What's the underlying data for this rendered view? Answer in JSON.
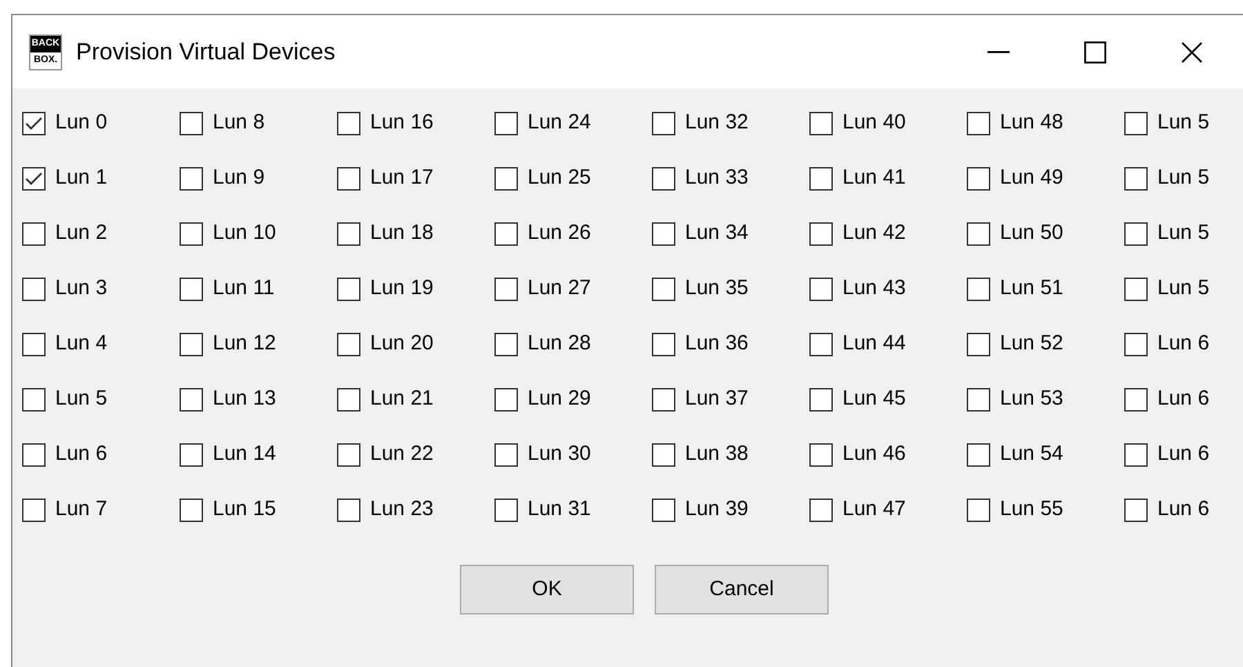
{
  "window": {
    "title": "Provision Virtual Devices",
    "icon_text": [
      "BACK",
      "BOX."
    ]
  },
  "luns": [
    {
      "label": "Lun 0",
      "checked": true
    },
    {
      "label": "Lun 1",
      "checked": true
    },
    {
      "label": "Lun 2",
      "checked": false
    },
    {
      "label": "Lun 3",
      "checked": false
    },
    {
      "label": "Lun 4",
      "checked": false
    },
    {
      "label": "Lun 5",
      "checked": false
    },
    {
      "label": "Lun 6",
      "checked": false
    },
    {
      "label": "Lun 7",
      "checked": false
    },
    {
      "label": "Lun 8",
      "checked": false
    },
    {
      "label": "Lun 9",
      "checked": false
    },
    {
      "label": "Lun 10",
      "checked": false
    },
    {
      "label": "Lun 11",
      "checked": false
    },
    {
      "label": "Lun 12",
      "checked": false
    },
    {
      "label": "Lun 13",
      "checked": false
    },
    {
      "label": "Lun 14",
      "checked": false
    },
    {
      "label": "Lun 15",
      "checked": false
    },
    {
      "label": "Lun 16",
      "checked": false
    },
    {
      "label": "Lun 17",
      "checked": false
    },
    {
      "label": "Lun 18",
      "checked": false
    },
    {
      "label": "Lun 19",
      "checked": false
    },
    {
      "label": "Lun 20",
      "checked": false
    },
    {
      "label": "Lun 21",
      "checked": false
    },
    {
      "label": "Lun 22",
      "checked": false
    },
    {
      "label": "Lun 23",
      "checked": false
    },
    {
      "label": "Lun 24",
      "checked": false
    },
    {
      "label": "Lun 25",
      "checked": false
    },
    {
      "label": "Lun 26",
      "checked": false
    },
    {
      "label": "Lun 27",
      "checked": false
    },
    {
      "label": "Lun 28",
      "checked": false
    },
    {
      "label": "Lun 29",
      "checked": false
    },
    {
      "label": "Lun 30",
      "checked": false
    },
    {
      "label": "Lun 31",
      "checked": false
    },
    {
      "label": "Lun 32",
      "checked": false
    },
    {
      "label": "Lun 33",
      "checked": false
    },
    {
      "label": "Lun 34",
      "checked": false
    },
    {
      "label": "Lun 35",
      "checked": false
    },
    {
      "label": "Lun 36",
      "checked": false
    },
    {
      "label": "Lun 37",
      "checked": false
    },
    {
      "label": "Lun 38",
      "checked": false
    },
    {
      "label": "Lun 39",
      "checked": false
    },
    {
      "label": "Lun 40",
      "checked": false
    },
    {
      "label": "Lun 41",
      "checked": false
    },
    {
      "label": "Lun 42",
      "checked": false
    },
    {
      "label": "Lun 43",
      "checked": false
    },
    {
      "label": "Lun 44",
      "checked": false
    },
    {
      "label": "Lun 45",
      "checked": false
    },
    {
      "label": "Lun 46",
      "checked": false
    },
    {
      "label": "Lun 47",
      "checked": false
    },
    {
      "label": "Lun 48",
      "checked": false
    },
    {
      "label": "Lun 49",
      "checked": false
    },
    {
      "label": "Lun 50",
      "checked": false
    },
    {
      "label": "Lun 51",
      "checked": false
    },
    {
      "label": "Lun 52",
      "checked": false
    },
    {
      "label": "Lun 53",
      "checked": false
    },
    {
      "label": "Lun 54",
      "checked": false
    },
    {
      "label": "Lun 55",
      "checked": false
    },
    {
      "label": "Lun 5",
      "checked": false
    },
    {
      "label": "Lun 5",
      "checked": false
    },
    {
      "label": "Lun 5",
      "checked": false
    },
    {
      "label": "Lun 5",
      "checked": false
    },
    {
      "label": "Lun 6",
      "checked": false
    },
    {
      "label": "Lun 6",
      "checked": false
    },
    {
      "label": "Lun 6",
      "checked": false
    },
    {
      "label": "Lun 6",
      "checked": false
    }
  ],
  "buttons": [
    "OK",
    "Cancel"
  ]
}
